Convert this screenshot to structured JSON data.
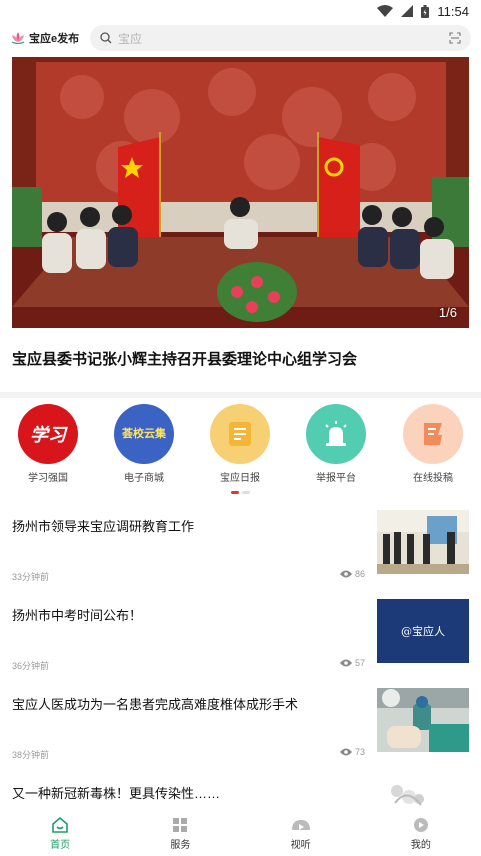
{
  "status_bar": {
    "time": "11:54"
  },
  "header": {
    "app_name": "宝应e发布",
    "search_placeholder": "宝应"
  },
  "hero": {
    "counter": "1/6",
    "title": "宝应县委书记张小辉主持召开县委理论中心组学习会"
  },
  "quick_nav": [
    {
      "label": "学习强国",
      "icon": "study-icon",
      "glyph": "学习",
      "color": "#d7151b"
    },
    {
      "label": "电子商城",
      "icon": "mall-icon",
      "glyph": "荟校云集",
      "color": "#3b63c4"
    },
    {
      "label": "宝应日报",
      "icon": "newspaper-icon",
      "glyph": "",
      "color": "#f5b637"
    },
    {
      "label": "举报平台",
      "icon": "alarm-icon",
      "glyph": "",
      "color": "#3cc2a6"
    },
    {
      "label": "在线投稿",
      "icon": "submit-icon",
      "glyph": "",
      "color": "#f28b5c"
    }
  ],
  "news": [
    {
      "title": "扬州市领导来宝应调研教育工作",
      "time": "33分钟前",
      "views": "86",
      "thumb": "meeting-photo"
    },
    {
      "title": "扬州市中考时间公布！",
      "time": "36分钟前",
      "views": "57",
      "thumb_text": "@宝应人"
    },
    {
      "title": "宝应人医成功为一名患者完成高难度椎体成形手术",
      "time": "38分钟前",
      "views": "73",
      "thumb": "surgery-photo"
    },
    {
      "title": "又一种新冠新毒株！更具传染性……",
      "time": "",
      "views": "",
      "thumb": "virus-photo"
    }
  ],
  "bottom_nav": [
    {
      "label": "首页",
      "icon": "home-icon",
      "active": true
    },
    {
      "label": "服务",
      "icon": "services-icon",
      "active": false
    },
    {
      "label": "视听",
      "icon": "video-icon",
      "active": false
    },
    {
      "label": "我的",
      "icon": "profile-icon",
      "active": false
    }
  ],
  "colors": {
    "accent": "#1f9d6b",
    "indicator": "#e0392b",
    "hero_red": "#9a2a1e"
  }
}
